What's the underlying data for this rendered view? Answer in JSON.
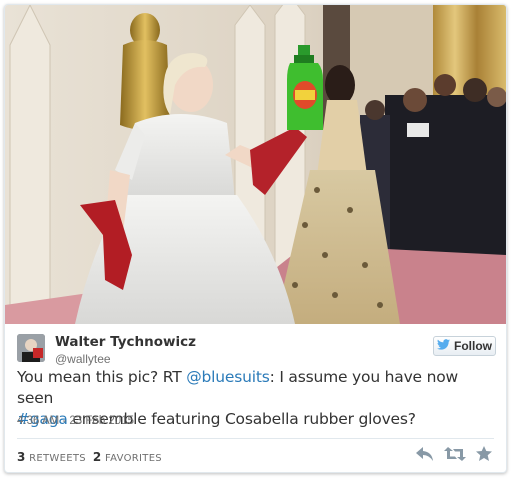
{
  "tweet": {
    "author_name": "Walter Tychnowicz",
    "author_handle": "@wallytee",
    "follow_label": "Follow",
    "text_parts": {
      "p1": "You mean this pic? RT ",
      "mention": "@bluesuits",
      "p2": ":  I assume you have now seen ",
      "hashtag": "#gaga",
      "p3": " ensemble featuring Cosabella rubber gloves?"
    },
    "timestamp": "4:36 AM - 23 Feb 2015",
    "retweets_count": "3",
    "retweets_label": "RETWEETS",
    "favorites_count": "2",
    "favorites_label": "FAVORITES"
  },
  "colors": {
    "link": "#2b7bb9",
    "text": "#333333",
    "muted": "#707070",
    "border": "#e1e8ed",
    "twitter_bird": "#55acee"
  },
  "icons": {
    "reply": "reply-icon",
    "retweet": "retweet-icon",
    "favorite": "star-icon",
    "bird": "twitter-bird-icon"
  }
}
